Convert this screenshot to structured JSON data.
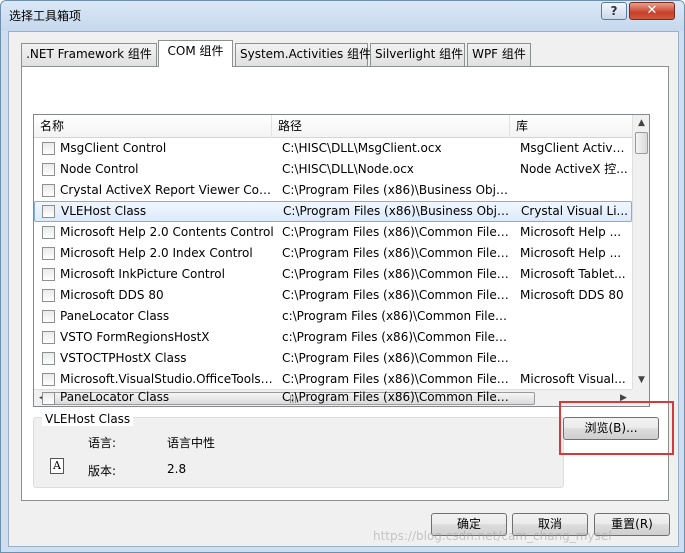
{
  "window": {
    "title": "选择工具箱项",
    "help_label": "?",
    "close_label": "✕"
  },
  "tabs": [
    {
      "label": ".NET Framework 组件"
    },
    {
      "label": "COM 组件",
      "active": true
    },
    {
      "label": "System.Activities 组件"
    },
    {
      "label": "Silverlight 组件"
    },
    {
      "label": "WPF 组件"
    }
  ],
  "list": {
    "columns": [
      "名称",
      "路径",
      "库"
    ],
    "rows": [
      {
        "name": "MsgClient Control",
        "path": "C:\\HISC\\DLL\\MsgClient.ocx",
        "lib": "MsgClient Active..."
      },
      {
        "name": "Node Control",
        "path": "C:\\HISC\\DLL\\Node.ocx",
        "lib": "Node ActiveX 控..."
      },
      {
        "name": "Crystal ActiveX Report Viewer Cont...",
        "path": "C:\\Program Files (x86)\\Business Obje...",
        "lib": ""
      },
      {
        "name": "VLEHost Class",
        "path": "C:\\Program Files (x86)\\Business Obje...",
        "lib": "Crystal Visual Li...",
        "selected": true
      },
      {
        "name": "Microsoft Help 2.0 Contents Control",
        "path": "C:\\Program Files (x86)\\Common Files...",
        "lib": "Microsoft Help ..."
      },
      {
        "name": "Microsoft Help 2.0 Index Control",
        "path": "C:\\Program Files (x86)\\Common Files...",
        "lib": "Microsoft Help ..."
      },
      {
        "name": "Microsoft InkPicture Control",
        "path": "C:\\Program Files (x86)\\Common Files...",
        "lib": "Microsoft Tablet..."
      },
      {
        "name": "Microsoft DDS 80",
        "path": "C:\\Program Files (x86)\\Common Files...",
        "lib": "Microsoft DDS 80"
      },
      {
        "name": "PaneLocator Class",
        "path": "c:\\Program Files (x86)\\Common Files...",
        "lib": ""
      },
      {
        "name": "VSTO FormRegionsHostX",
        "path": "c:\\Program Files (x86)\\Common Files...",
        "lib": ""
      },
      {
        "name": "VSTOCTPHostX Class",
        "path": "C:\\Program Files (x86)\\Common Files...",
        "lib": ""
      },
      {
        "name": "Microsoft.VisualStudio.OfficeTools....",
        "path": "C:\\Program Files (x86)\\Common Files...",
        "lib": "Microsoft Visual..."
      },
      {
        "name": "PaneLocator Class",
        "path": "C:\\Program Files (x86)\\Common Files...",
        "lib": ""
      }
    ]
  },
  "details": {
    "title": "VLEHost Class",
    "language_label": "语言:",
    "language_value": "语言中性",
    "version_label": "版本:",
    "version_value": "2.8",
    "icon": "document-icon"
  },
  "buttons": {
    "browse": "浏览(B)...",
    "ok": "确定",
    "cancel": "取消",
    "reset": "重置(R)"
  },
  "scroll": {
    "up": "▲",
    "down": "▼",
    "left": "◀",
    "right": "▶",
    "grip": "|||"
  },
  "watermark": "https://blog.csdn.net/cam_chang_mysel",
  "colors": {
    "highlight_border": "#d53a3a",
    "selected_row": "#dbeafb"
  }
}
